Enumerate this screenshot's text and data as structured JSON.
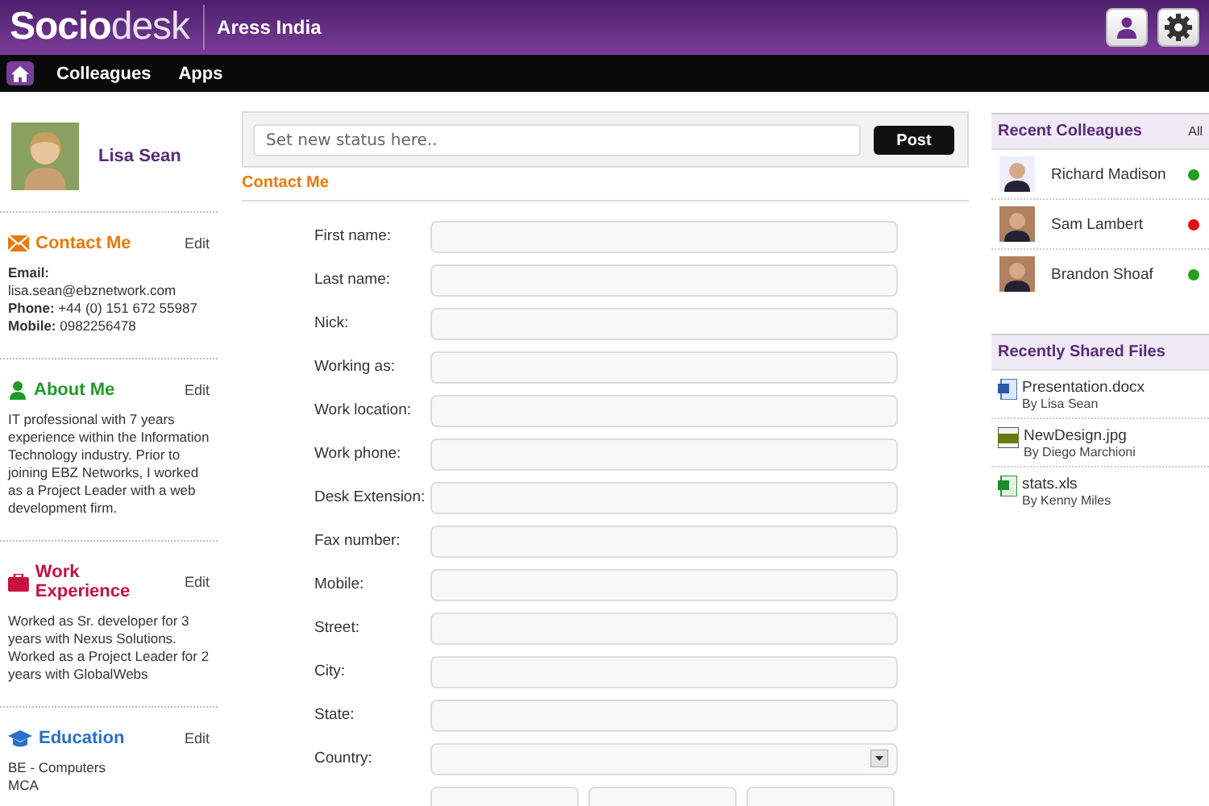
{
  "header": {
    "logo_bold": "Socio",
    "logo_light": "desk",
    "company": "Aress India"
  },
  "nav": {
    "items": [
      {
        "label": "Colleagues"
      },
      {
        "label": "Apps"
      }
    ]
  },
  "profile": {
    "name": "Lisa Sean"
  },
  "sections": [
    {
      "kind": "contact",
      "title": "Contact Me",
      "edit": "Edit",
      "lines": [
        "**Email:** lisa.sean@ebznetwork.com",
        "**Phone:** +44 (0) 151 672 55987",
        "**Mobile:** 0982256478"
      ]
    },
    {
      "kind": "about",
      "title": "About Me",
      "edit": "Edit",
      "lines": [
        "IT professional with 7 years experience within the Information Technology industry. Prior to joining EBZ Networks, I worked as a Project Leader with a web development firm."
      ]
    },
    {
      "kind": "work",
      "title": "Work Experience",
      "edit": "Edit",
      "lines": [
        "Worked as Sr. developer for 3 years with Nexus Solutions. Worked as a Project Leader for 2 years with GlobalWebs"
      ]
    },
    {
      "kind": "education",
      "title": "Education",
      "edit": "Edit",
      "lines": [
        "BE - Computers",
        "MCA"
      ]
    }
  ],
  "status": {
    "placeholder": "Set new status here..",
    "button": "Post"
  },
  "form": {
    "title": "Contact Me",
    "fields": [
      {
        "kind": "text",
        "label": "First name:"
      },
      {
        "kind": "text",
        "label": "Last name:"
      },
      {
        "kind": "text",
        "label": "Nick:"
      },
      {
        "kind": "text",
        "label": "Working as:"
      },
      {
        "kind": "text",
        "label": "Work location:"
      },
      {
        "kind": "text",
        "label": "Work phone:"
      },
      {
        "kind": "text",
        "label": "Desk Extension:"
      },
      {
        "kind": "text",
        "label": "Fax number:"
      },
      {
        "kind": "text",
        "label": "Mobile:"
      },
      {
        "kind": "text",
        "label": "Street:"
      },
      {
        "kind": "text",
        "label": "City:"
      },
      {
        "kind": "text",
        "label": "State:"
      },
      {
        "kind": "select",
        "label": "Country:"
      },
      {
        "kind": "triple"
      }
    ]
  },
  "colleagues": {
    "title": "Recent Colleagues",
    "all": "All",
    "items": [
      {
        "name": "Richard Madison",
        "color": "#22a01c"
      },
      {
        "name": "Sam Lambert",
        "color": "#e01010"
      },
      {
        "name": "Brandon Shoaf",
        "color": "#22a01c"
      }
    ]
  },
  "files": {
    "title": "Recently Shared Files",
    "items": [
      {
        "kind": "word",
        "name": "Presentation.docx",
        "by": "By Lisa Sean"
      },
      {
        "kind": "image",
        "name": "NewDesign.jpg",
        "by": "By Diego Marchioni"
      },
      {
        "kind": "excel",
        "name": "stats.xls",
        "by": "By Kenny Miles"
      }
    ]
  }
}
